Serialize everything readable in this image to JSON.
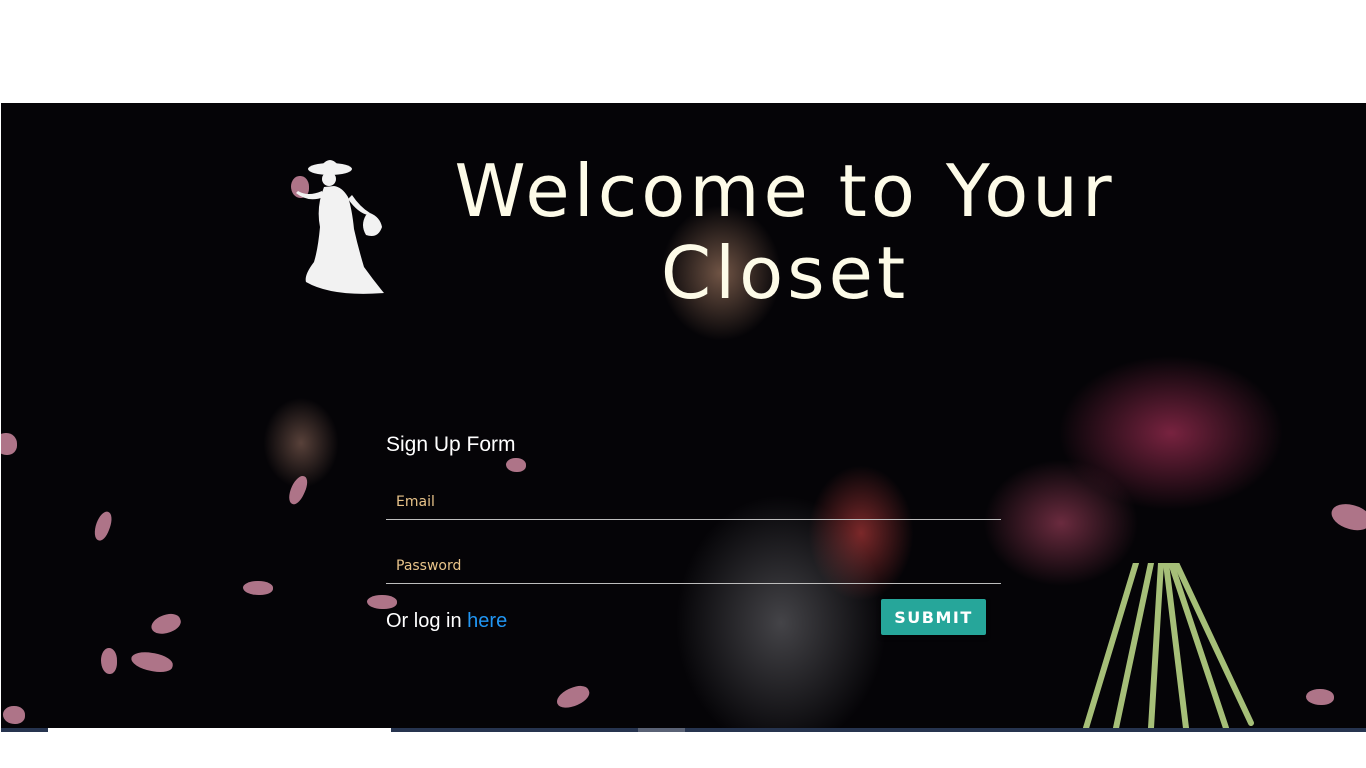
{
  "header": {
    "title": "Welcome to Your Closet"
  },
  "logo": {
    "icon": "lady-silhouette-icon"
  },
  "signup_form": {
    "title": "Sign Up Form",
    "email_placeholder": "Email",
    "password_placeholder": "Password",
    "login_prefix": "Or log in",
    "login_link": "here",
    "submit_label": "SUBMIT"
  },
  "colors": {
    "title_text": "#fdfbe8",
    "submit_bg": "#26a69a",
    "link": "#2196f3",
    "placeholder": "#e9c48a"
  }
}
